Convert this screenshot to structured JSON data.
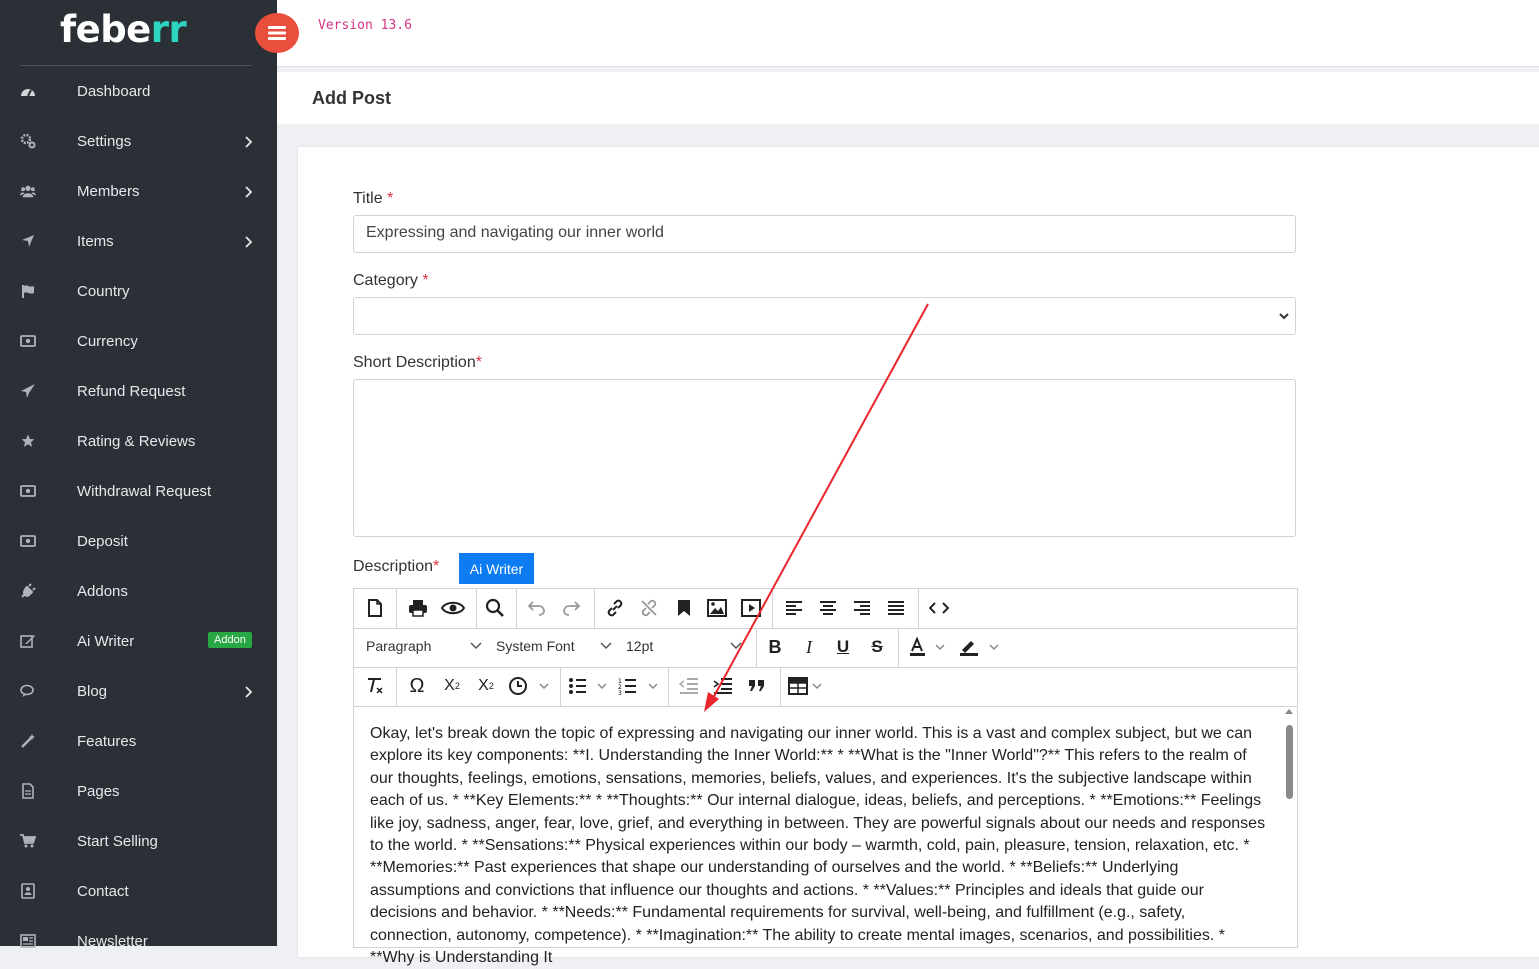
{
  "app": {
    "logo_main": "febe",
    "logo_accent": "rr",
    "version": "Version 13.6"
  },
  "sidebar": {
    "items": [
      {
        "label": "Dashboard",
        "icon": "dashboard-icon",
        "has_submenu": false
      },
      {
        "label": "Settings",
        "icon": "gears-icon",
        "has_submenu": true
      },
      {
        "label": "Members",
        "icon": "users-icon",
        "has_submenu": true
      },
      {
        "label": "Items",
        "icon": "location-arrow-icon",
        "has_submenu": true
      },
      {
        "label": "Country",
        "icon": "flag-icon",
        "has_submenu": false
      },
      {
        "label": "Currency",
        "icon": "money-icon",
        "has_submenu": false
      },
      {
        "label": "Refund Request",
        "icon": "paper-plane-icon",
        "has_submenu": false
      },
      {
        "label": "Rating & Reviews",
        "icon": "star-icon",
        "has_submenu": false
      },
      {
        "label": "Withdrawal Request",
        "icon": "money-icon",
        "has_submenu": false
      },
      {
        "label": "Deposit",
        "icon": "money-icon",
        "has_submenu": false
      },
      {
        "label": "Addons",
        "icon": "plug-icon",
        "has_submenu": false
      },
      {
        "label": "Ai Writer",
        "icon": "edit-icon",
        "has_submenu": false,
        "badge": "Addon"
      },
      {
        "label": "Blog",
        "icon": "comments-icon",
        "has_submenu": true
      },
      {
        "label": "Features",
        "icon": "magic-wand-icon",
        "has_submenu": false
      },
      {
        "label": "Pages",
        "icon": "file-icon",
        "has_submenu": false
      },
      {
        "label": "Start Selling",
        "icon": "cart-icon",
        "has_submenu": false
      },
      {
        "label": "Contact",
        "icon": "contact-book-icon",
        "has_submenu": false
      },
      {
        "label": "Newsletter",
        "icon": "newspaper-icon",
        "has_submenu": false
      }
    ]
  },
  "page": {
    "title": "Add Post"
  },
  "form": {
    "title_label": "Title",
    "title_value": "Expressing and navigating our inner world",
    "category_label": "Category",
    "category_value": "",
    "short_desc_label": "Short Description",
    "short_desc_value": "",
    "description_label": "Description",
    "required_mark": "*",
    "ai_writer_button": "Ai Writer"
  },
  "editor": {
    "block_format": "Paragraph",
    "font_family": "System Font",
    "font_size": "12pt",
    "content": "Okay, let's break down the topic of expressing and navigating our inner world. This is a vast and complex subject, but we can explore its key components: **I. Understanding the Inner World:** * **What is the \"Inner World\"?** This refers to the realm of our thoughts, feelings, emotions, sensations, memories, beliefs, values, and experiences. It's the subjective landscape within each of us. * **Key Elements:** * **Thoughts:** Our internal dialogue, ideas, beliefs, and perceptions. * **Emotions:** Feelings like joy, sadness, anger, fear, love, grief, and everything in between. They are powerful signals about our needs and responses to the world. * **Sensations:** Physical experiences within our body – warmth, cold, pain, pleasure, tension, relaxation, etc. * **Memories:** Past experiences that shape our understanding of ourselves and the world. * **Beliefs:** Underlying assumptions and convictions that influence our thoughts and actions. * **Values:** Principles and ideals that guide our decisions and behavior. * **Needs:** Fundamental requirements for survival, well-being, and fulfillment (e.g., safety, connection, autonomy, competence). * **Imagination:** The ability to create mental images, scenarios, and possibilities. * **Why is Understanding It"
  },
  "colors": {
    "sidebar_bg": "#2b2f36",
    "accent": "#2dd4bf",
    "toggle": "#ea4e3d",
    "ai_button": "#0d7cf2",
    "badge": "#28a745",
    "arrow": "#e8262b"
  }
}
